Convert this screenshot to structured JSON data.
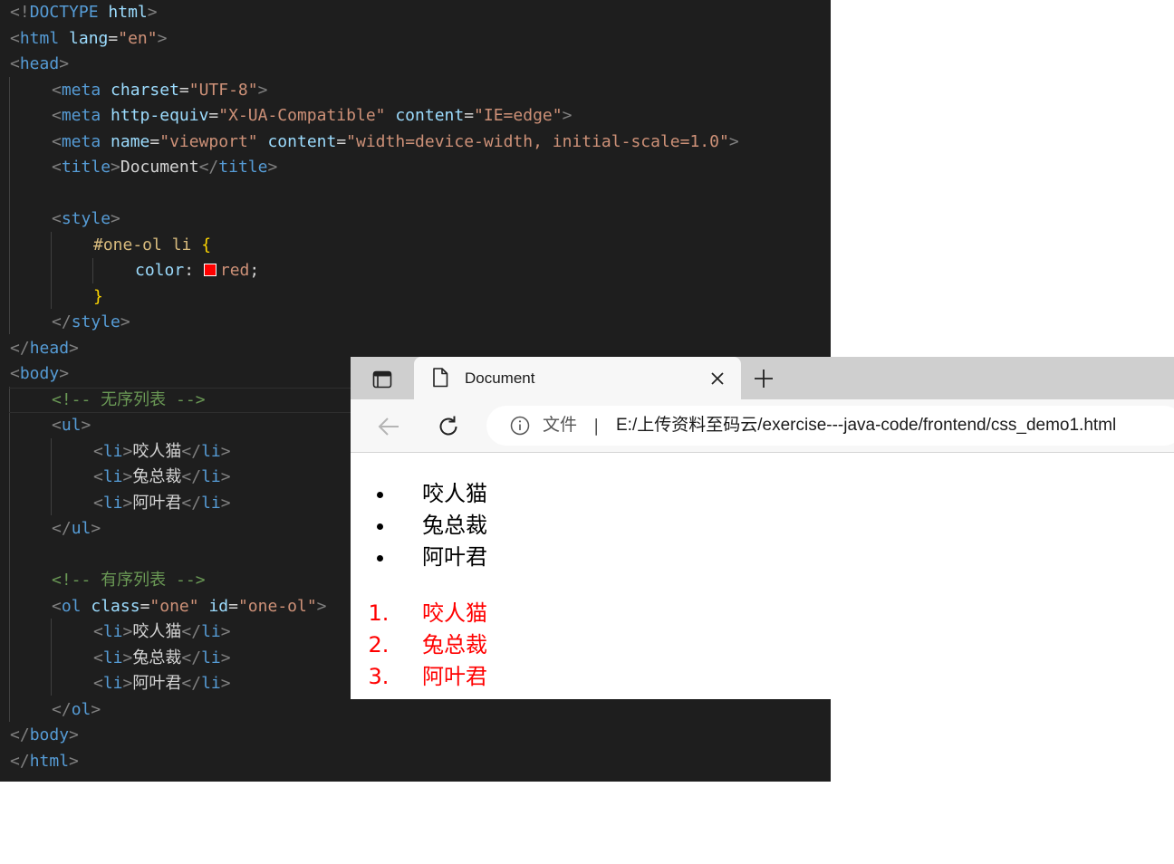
{
  "editor": {
    "lines": [
      "<!DOCTYPE html>",
      "<html lang=\"en\">",
      "<head>",
      "<meta charset=\"UTF-8\">",
      "<meta http-equiv=\"X-UA-Compatible\" content=\"IE=edge\">",
      "<meta name=\"viewport\" content=\"width=device-width, initial-scale=1.0\">",
      "<title>Document</title>",
      "",
      "<style>",
      "#one-ol li {",
      "color: red;",
      "}",
      "</style>",
      "</head>",
      "<body>",
      "<!-- 无序列表 -->",
      "<ul>",
      "<li>咬人猫</li>",
      "<li>兔总裁</li>",
      "<li>阿叶君</li>",
      "</ul>",
      "",
      "<!-- 有序列表 -->",
      "<ol class=\"one\" id=\"one-ol\">",
      "<li>咬人猫</li>",
      "<li>兔总裁</li>",
      "<li>阿叶君</li>",
      "</ol>",
      "</body>",
      "</html>"
    ],
    "color_swatch": "#ff0000"
  },
  "browser": {
    "tab_title": "Document",
    "address_label": "文件",
    "address_separator": "|",
    "url": "E:/上传资料至码云/exercise---java-code/frontend/css_demo1.html",
    "unordered_list": [
      "咬人猫",
      "兔总裁",
      "阿叶君"
    ],
    "ordered_list": [
      "咬人猫",
      "兔总裁",
      "阿叶君"
    ],
    "ordered_list_color": "#ff0000"
  }
}
